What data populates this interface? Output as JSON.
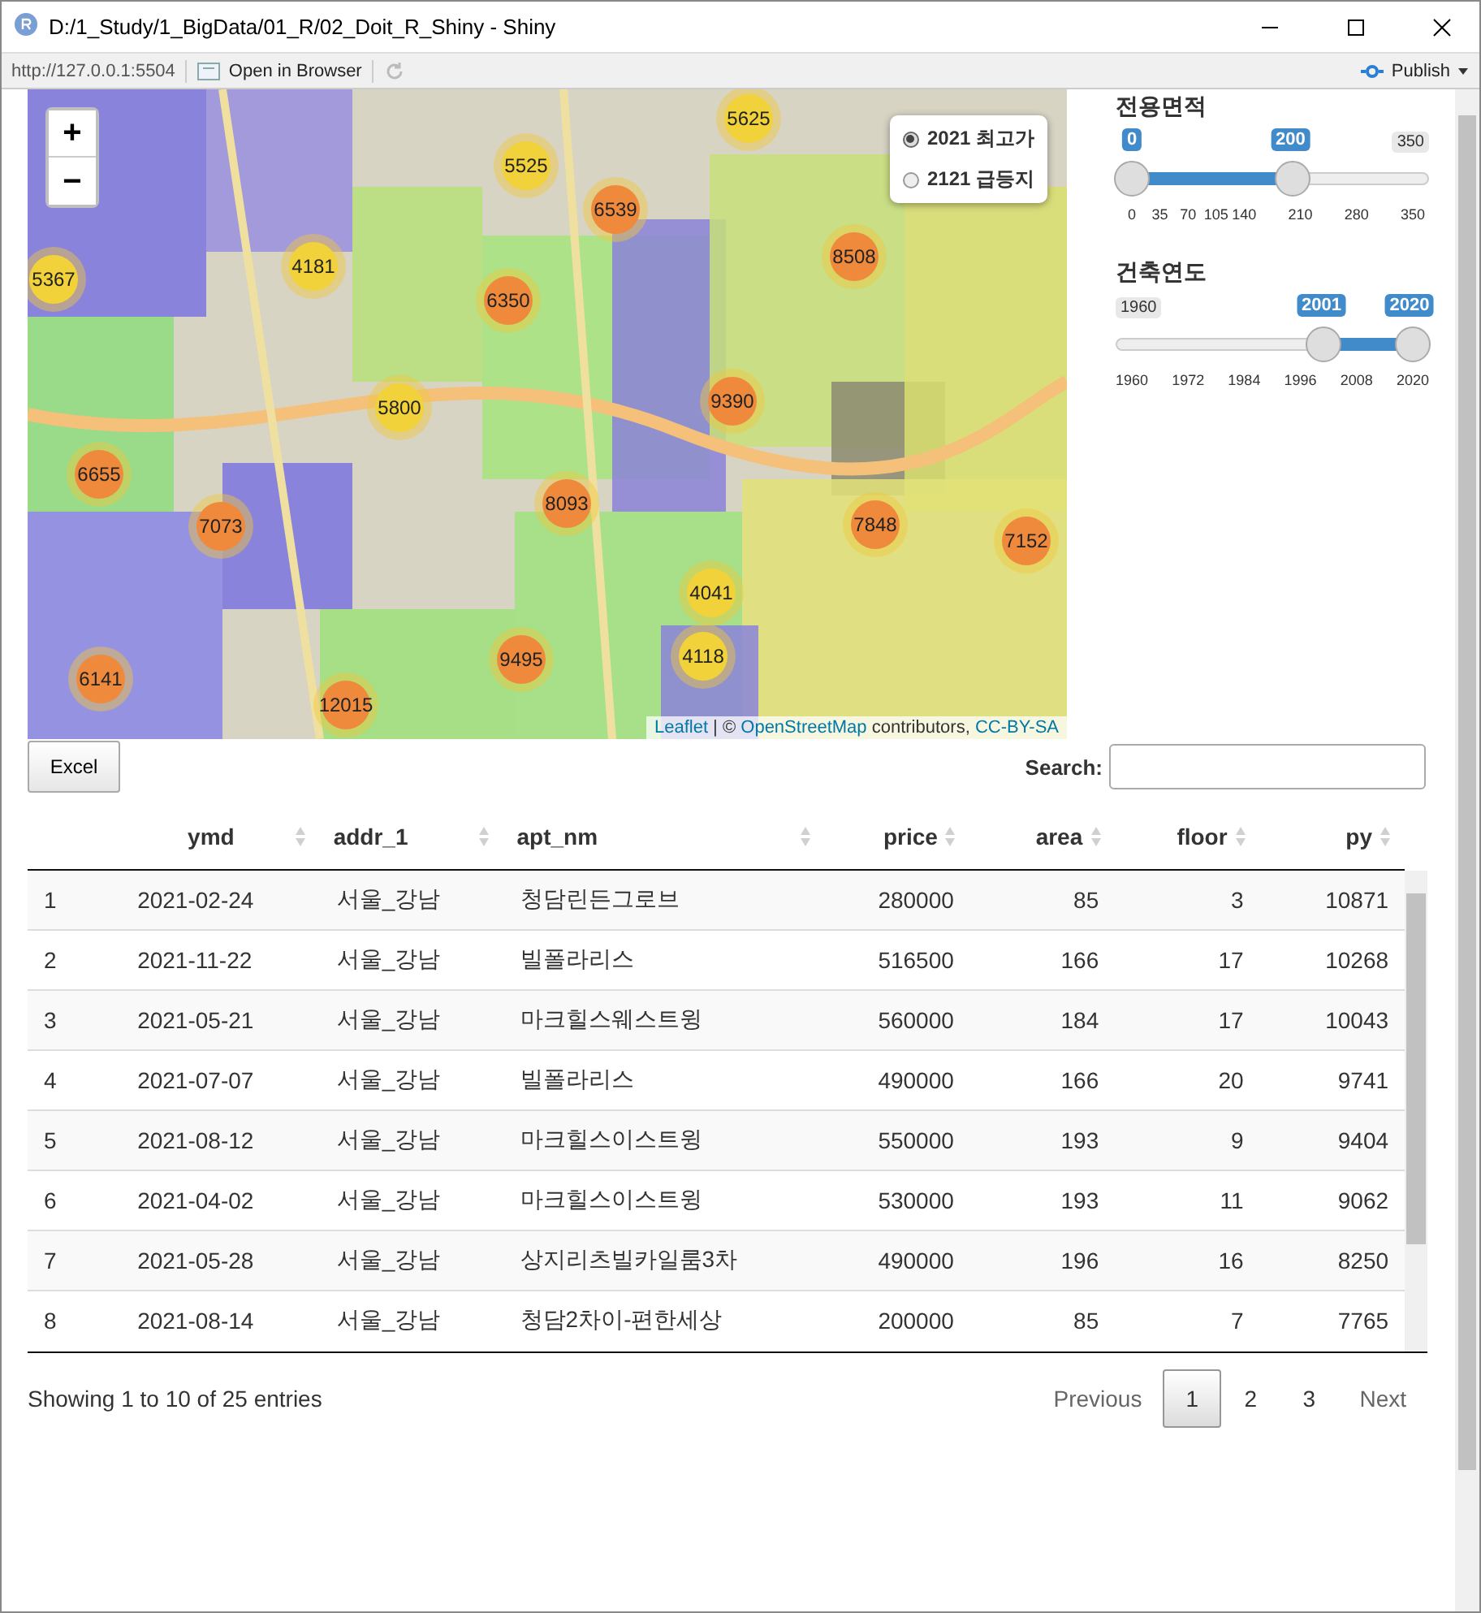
{
  "window": {
    "title": "D:/1_Study/1_BigData/01_R/02_Doit_R_Shiny - Shiny",
    "url": "http://127.0.0.1:5504",
    "open_in_browser": "Open in Browser",
    "publish": "Publish"
  },
  "map": {
    "zoom_in": "+",
    "zoom_out": "−",
    "layers": [
      {
        "label": "2021 최고가",
        "selected": true
      },
      {
        "label": "2121 급등지",
        "selected": false
      }
    ],
    "markers": [
      {
        "label": "5625",
        "color": "#f1d23b"
      },
      {
        "label": "5525",
        "color": "#f1d23b"
      },
      {
        "label": "6539",
        "color": "#ef8a3c"
      },
      {
        "label": "8508",
        "color": "#ef8a3c"
      },
      {
        "label": "4181",
        "color": "#f1d23b"
      },
      {
        "label": "5367",
        "color": "#f1d23b"
      },
      {
        "label": "6350",
        "color": "#ef8a3c"
      },
      {
        "label": "5800",
        "color": "#f1d23b"
      },
      {
        "label": "9390",
        "color": "#ef8a3c"
      },
      {
        "label": "6655",
        "color": "#ef8a3c"
      },
      {
        "label": "8093",
        "color": "#ef8a3c"
      },
      {
        "label": "7073",
        "color": "#ef8a3c"
      },
      {
        "label": "7848",
        "color": "#ef8a3c"
      },
      {
        "label": "7152",
        "color": "#ef8a3c"
      },
      {
        "label": "4041",
        "color": "#f1d23b"
      },
      {
        "label": "4118",
        "color": "#f1d23b"
      },
      {
        "label": "9495",
        "color": "#ef8a3c"
      },
      {
        "label": "6141",
        "color": "#ef8a3c"
      },
      {
        "label": "12015",
        "color": "#ef8a3c"
      }
    ],
    "attribution": [
      {
        "kind": "link",
        "text": "Leaflet"
      },
      {
        "kind": "text",
        "text": " | © "
      },
      {
        "kind": "link",
        "text": "OpenStreetMap"
      },
      {
        "kind": "text",
        "text": " contributors, "
      },
      {
        "kind": "link",
        "text": "CC-BY-SA"
      }
    ]
  },
  "sliders": [
    {
      "label": "전용면적",
      "edges": [
        {
          "kind": "max",
          "text": "350"
        }
      ],
      "handles": [
        {
          "text": "0",
          "level": 0
        },
        {
          "text": "200",
          "level": 0.571
        }
      ],
      "grid": [
        "0",
        "35",
        "70",
        "105",
        "140",
        "210",
        "280",
        "350"
      ]
    },
    {
      "label": "건축연도",
      "edges": [
        {
          "kind": "min",
          "text": "1960"
        }
      ],
      "handles": [
        {
          "text": "2001",
          "level": 0.683
        },
        {
          "text": "2020",
          "level": 1
        }
      ],
      "grid": [
        "1960",
        "1972",
        "1984",
        "1996",
        "2008",
        "2020"
      ]
    }
  ],
  "table": {
    "excel": "Excel",
    "search_label": "Search:",
    "columns": [
      "",
      "ymd",
      "addr_1",
      "apt_nm",
      "price",
      "area",
      "floor",
      "py"
    ],
    "rows": [
      [
        "1",
        "2021-02-24",
        "서울_강남",
        "청담린든그로브",
        "280000",
        "85",
        "3",
        "10871"
      ],
      [
        "2",
        "2021-11-22",
        "서울_강남",
        "빌폴라리스",
        "516500",
        "166",
        "17",
        "10268"
      ],
      [
        "3",
        "2021-05-21",
        "서울_강남",
        "마크힐스웨스트윙",
        "560000",
        "184",
        "17",
        "10043"
      ],
      [
        "4",
        "2021-07-07",
        "서울_강남",
        "빌폴라리스",
        "490000",
        "166",
        "20",
        "9741"
      ],
      [
        "5",
        "2021-08-12",
        "서울_강남",
        "마크힐스이스트윙",
        "550000",
        "193",
        "9",
        "9404"
      ],
      [
        "6",
        "2021-04-02",
        "서울_강남",
        "마크힐스이스트윙",
        "530000",
        "193",
        "11",
        "9062"
      ],
      [
        "7",
        "2021-05-28",
        "서울_강남",
        "상지리츠빌카일룸3차",
        "490000",
        "196",
        "16",
        "8250"
      ],
      [
        "8",
        "2021-08-14",
        "서울_강남",
        "청담2차이-편한세상",
        "200000",
        "85",
        "7",
        "7765"
      ]
    ],
    "info": "Showing 1 to 10 of 25 entries",
    "pager": [
      {
        "kind": "prev",
        "label": "Previous",
        "selected": false
      },
      {
        "kind": "page",
        "label": "1",
        "selected": true
      },
      {
        "kind": "page",
        "label": "2",
        "selected": false
      },
      {
        "kind": "page",
        "label": "3",
        "selected": false
      },
      {
        "kind": "next",
        "label": "Next",
        "selected": false
      }
    ]
  }
}
